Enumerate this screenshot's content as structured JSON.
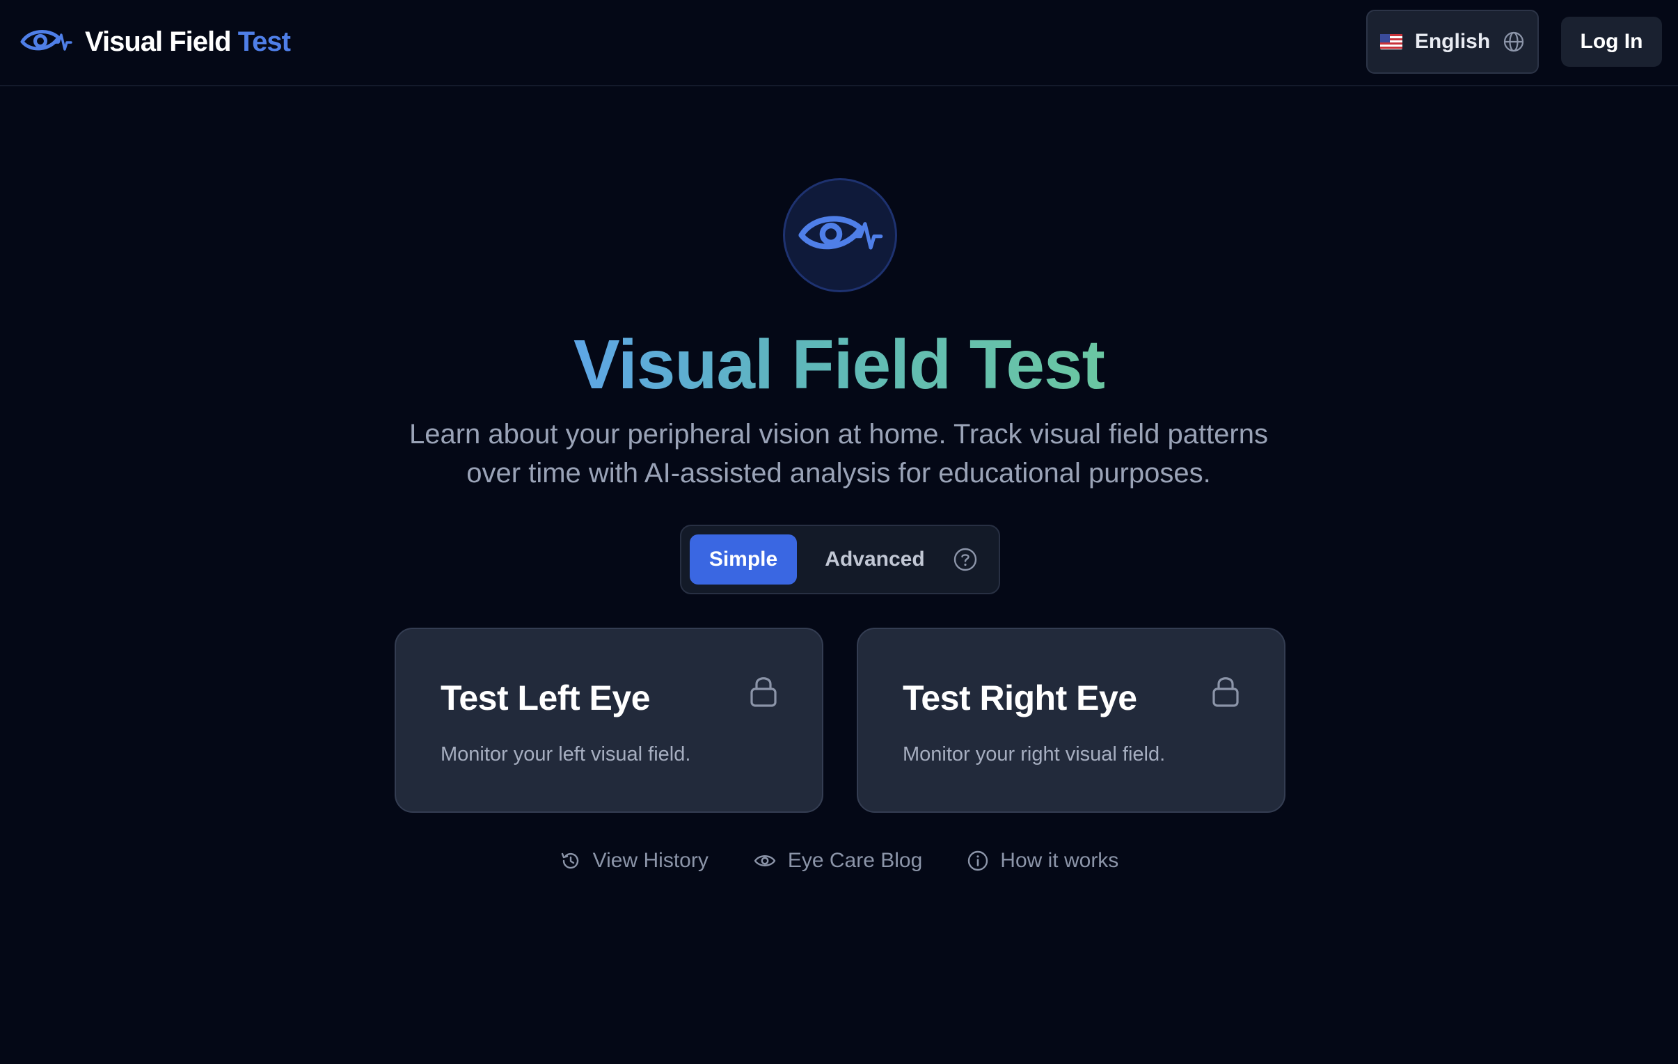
{
  "header": {
    "brand": {
      "title_part1": "Visual Field",
      "title_part2": "Test",
      "icon": "eye-pulse-icon"
    },
    "language": {
      "flag": "us-flag-icon",
      "label": "English",
      "icon": "globe-icon"
    },
    "login_label": "Log In"
  },
  "hero": {
    "icon": "eye-pulse-icon",
    "title": "Visual Field Test",
    "subtitle": "Learn about your peripheral vision at home. Track visual field patterns over time with AI-assisted analysis for educational purposes."
  },
  "mode_toggle": {
    "options": [
      "Simple",
      "Advanced"
    ],
    "selected": "Simple",
    "help_icon": "question-circle-icon"
  },
  "cards": [
    {
      "title": "Test Left Eye",
      "description": "Monitor your left visual field.",
      "icon": "lock-icon"
    },
    {
      "title": "Test Right Eye",
      "description": "Monitor your right visual field.",
      "icon": "lock-icon"
    }
  ],
  "footer_links": [
    {
      "label": "View History",
      "icon": "history-icon"
    },
    {
      "label": "Eye Care Blog",
      "icon": "eye-icon"
    },
    {
      "label": "How it works",
      "icon": "info-icon"
    }
  ],
  "colors": {
    "background": "#040816",
    "accent": "#3a67e2",
    "brand_blue": "#4f7fe8",
    "card": "#222a3b",
    "title_gradient_start": "#5ea6e6",
    "title_gradient_end": "#6bc7a2"
  }
}
